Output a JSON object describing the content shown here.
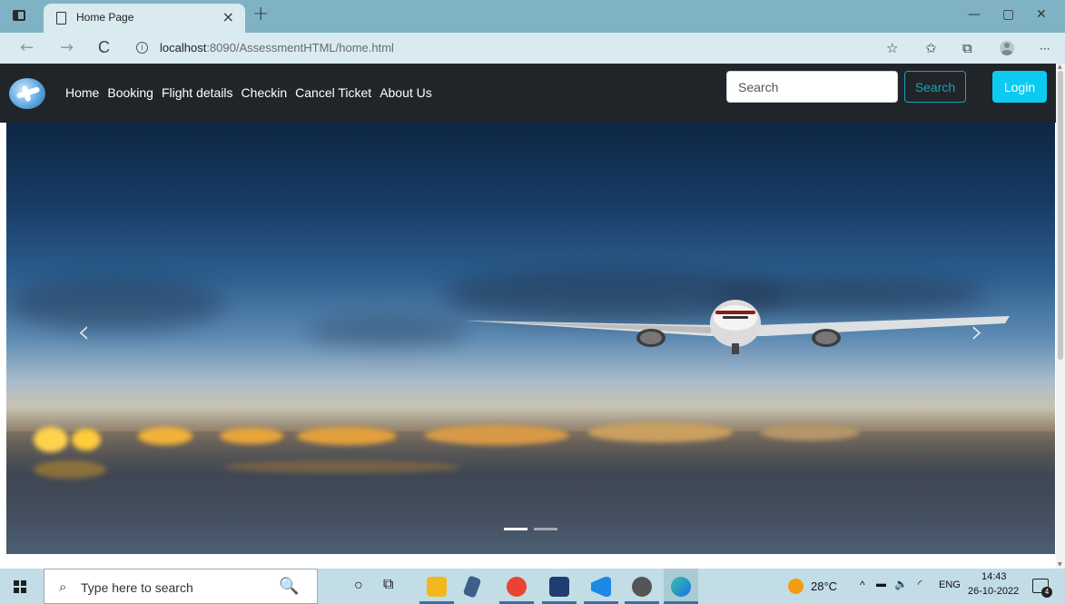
{
  "browser": {
    "tab_title": "Home Page",
    "tab_close": "×",
    "new_tab": "+",
    "url_host": "localhost",
    "url_rest": ":8090/AssessmentHTML/home.html",
    "back": "←",
    "forward": "→",
    "refresh": "C",
    "info": "i",
    "more": "···",
    "minimize": "—",
    "maximize": "▢",
    "close": "✕"
  },
  "site": {
    "nav": [
      "Home",
      "Booking",
      "Flight details",
      "Checkin",
      "Cancel Ticket",
      "About Us"
    ],
    "search_placeholder": "Search",
    "search_button": "Search",
    "login_button": "Login",
    "colors": {
      "navbar": "#212529",
      "info": "#17a2b8",
      "login": "#0dcaf0"
    }
  },
  "carousel": {
    "prev": "‹",
    "next": "›",
    "slide_count": 2,
    "active_slide": 1
  },
  "taskbar": {
    "search_placeholder": "Type here to search",
    "temperature": "28°C",
    "language": "ENG",
    "time": "14:43",
    "date": "26-10-2022",
    "notification_count": "4"
  }
}
